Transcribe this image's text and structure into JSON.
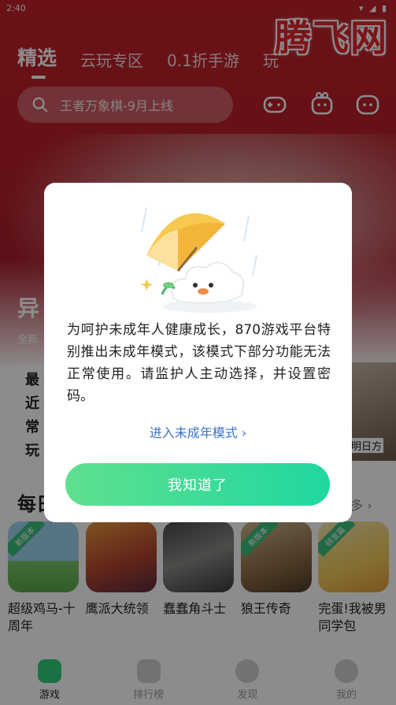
{
  "status_bar": {
    "time": "2:40"
  },
  "watermark": "腾飞网",
  "top_tabs": [
    {
      "label": "精选",
      "active": true
    },
    {
      "label": "云玩专区",
      "active": false
    },
    {
      "label": "0.1折手游",
      "active": false
    },
    {
      "label": "玩",
      "active": false
    }
  ],
  "search": {
    "placeholder": "王者万象棋-9月上线"
  },
  "header_icons": [
    "gamepad-icon",
    "gift-icon",
    "message-icon"
  ],
  "featured": {
    "title": "异",
    "subtitle": "全新",
    "left_card_text": "最近常玩",
    "right_card_text": "明日方"
  },
  "daily": {
    "title": "每日",
    "more": "多 ›"
  },
  "games": [
    {
      "name": "超级鸡马-十周年",
      "badge": "新版本"
    },
    {
      "name": "鹰派大统领",
      "badge": ""
    },
    {
      "name": "蠢蠢角斗士",
      "badge": ""
    },
    {
      "name": "狼王传奇",
      "badge": "新版本"
    },
    {
      "name": "完蛋!我被男同学包",
      "badge": "研发篇"
    }
  ],
  "bottom_nav": [
    {
      "label": "游戏",
      "active": true
    },
    {
      "label": "排行榜",
      "active": false
    },
    {
      "label": "发现",
      "active": false
    },
    {
      "label": "我的",
      "active": false
    }
  ],
  "dialog": {
    "message": "为呵护未成年人健康成长，870游戏平台特别推出未成年模式，该模式下部分功能无法正常使用。请监护人主动选择，并设置密码。",
    "link_label": "进入未成年模式",
    "confirm_label": "我知道了"
  },
  "colors": {
    "brand_red": "#c1222b",
    "accent_green": "#2fdc98",
    "link_blue": "#3b74c6"
  }
}
